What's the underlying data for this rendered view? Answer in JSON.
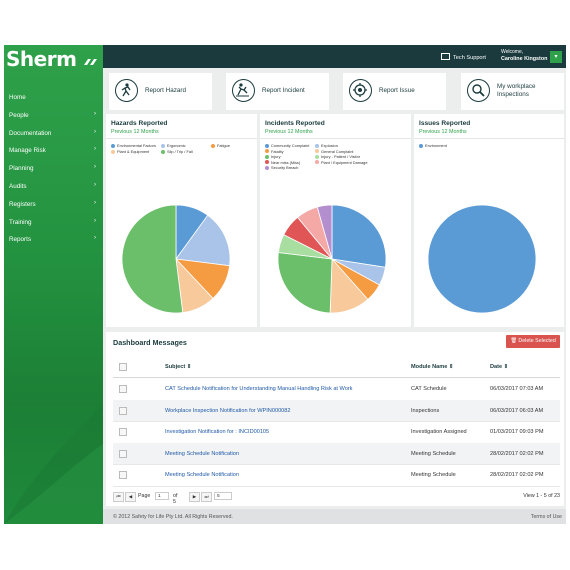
{
  "app": {
    "logo": "Sherm"
  },
  "sidebar": {
    "items": [
      {
        "label": "Home",
        "arrow": ""
      },
      {
        "label": "People",
        "arrow": "›"
      },
      {
        "label": "Documentation",
        "arrow": "›"
      },
      {
        "label": "Manage Risk",
        "arrow": "›"
      },
      {
        "label": "Planning",
        "arrow": "›"
      },
      {
        "label": "Audits",
        "arrow": "›"
      },
      {
        "label": "Registers",
        "arrow": "›"
      },
      {
        "label": "Training",
        "arrow": "›"
      },
      {
        "label": "Reports",
        "arrow": "›"
      }
    ]
  },
  "topbar": {
    "support": "Tech Support",
    "welcome": "Welcome,",
    "user_name": "Caroline Kingston",
    "dropdown": "▾"
  },
  "actions": [
    {
      "label": "Report Hazard",
      "icon": "hazard-icon"
    },
    {
      "label": "Report Incident",
      "icon": "incident-icon"
    },
    {
      "label": "Report Issue",
      "icon": "issue-icon"
    },
    {
      "label": "My workplace Inspections",
      "icon": "inspection-icon"
    }
  ],
  "chart_data": [
    {
      "type": "pie",
      "title": "Hazards Reported",
      "subtitle": "Previous 12 Months",
      "categories": [
        "Environmental Factors",
        "Ergonomic",
        "Fatigue",
        "Plant & Equipment",
        "Slip / Trip / Fall"
      ],
      "values": [
        10,
        17,
        11,
        10,
        52
      ],
      "colors": [
        "#5b9bd5",
        "#a9c4e8",
        "#f59b42",
        "#f8c99b",
        "#6cbf6a"
      ]
    },
    {
      "type": "pie",
      "title": "Incidents Reported",
      "subtitle": "Previous 12 Months",
      "categories": [
        "Community Complaint",
        "Explosion",
        "Fatality",
        "General Complaint",
        "Injury",
        "Injury - Patient / Visitor",
        "Near miss (Miss)",
        "Plant / Equipment Damage",
        "Security Breach"
      ],
      "values": [
        25,
        5,
        5,
        11,
        24,
        5,
        6,
        6,
        4
      ],
      "colors": [
        "#5b9bd5",
        "#a9c4e8",
        "#f59b42",
        "#f8c99b",
        "#6cbf6a",
        "#a8dea0",
        "#e05555",
        "#f4a9a7",
        "#b48fd0"
      ]
    },
    {
      "type": "pie",
      "title": "Issues Reported",
      "subtitle": "Previous 12 Months",
      "categories": [
        "Environment"
      ],
      "values": [
        100
      ],
      "colors": [
        "#5b9bd5"
      ]
    }
  ],
  "messages": {
    "title": "Dashboard Messages",
    "delete_label": "🗑 Delete Selected",
    "columns": {
      "subject": "Subject ⇕",
      "module": "Module Name ⇕",
      "date": "Date ⇕"
    },
    "rows": [
      {
        "subject": "CAT Schedule Notification for Understanding Manual Handling Risk at Work",
        "module": "CAT Schedule",
        "date": "06/03/2017 07:03 AM"
      },
      {
        "subject": "Workplace Inspection Notification for WPIN000082",
        "module": "Inspections",
        "date": "06/03/2017 06:03 AM"
      },
      {
        "subject": "Investigation Notification for : INCID00105",
        "module": "Investigation Assigned",
        "date": "01/03/2017 09:03 PM"
      },
      {
        "subject": "Meeting Schedule Notification",
        "module": "Meeting Schedule",
        "date": "28/02/2017 02:02 PM"
      },
      {
        "subject": "Meeting Schedule Notification",
        "module": "Meeting Schedule",
        "date": "28/02/2017 02:02 PM"
      }
    ],
    "pager": {
      "page_label": "Page",
      "page_value": "1",
      "of_label": "of 5",
      "size_value": "5",
      "view_info": "View 1 - 5 of 23"
    }
  },
  "footer": {
    "copyright": "© 2012 Safety for Life Pty Ltd. All Rights Reserved.",
    "terms": "Terms of Use"
  }
}
